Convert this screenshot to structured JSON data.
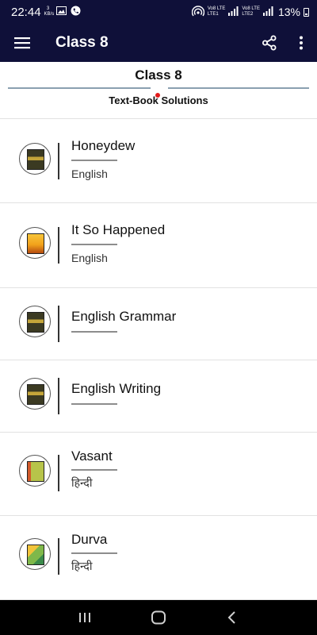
{
  "status": {
    "time": "22:44",
    "kbs_value": "3",
    "kbs_unit": "KB/s",
    "vo_lte1": "Vo8 LTE",
    "lte1": "LTE1",
    "vo_lte2": "Vo8 LTE",
    "lte2": "LTE2",
    "battery": "13%"
  },
  "appbar": {
    "title": "Class 8"
  },
  "header": {
    "class_label": "Class 8",
    "subtitle": "Text-Book Solutions"
  },
  "books": [
    {
      "title": "Honeydew",
      "language": "English",
      "cover_color": "#3b3a22",
      "cover_accent": "#c4a53a"
    },
    {
      "title": "It So Happened",
      "language": "English",
      "cover_color": "#f2a21b",
      "cover_accent": "#b54b10"
    },
    {
      "title": "English Grammar",
      "language": "",
      "cover_color": "#3b3a22",
      "cover_accent": "#c4a53a"
    },
    {
      "title": "English Writing",
      "language": "",
      "cover_color": "#3b3a22",
      "cover_accent": "#c4a53a"
    },
    {
      "title": "Vasant",
      "language": "हिन्दी",
      "cover_color": "#8fa83a",
      "cover_accent": "#d15a2a"
    },
    {
      "title": "Durva",
      "language": "हिन्दी",
      "cover_color": "#7fb84a",
      "cover_accent": "#f2c43a"
    }
  ],
  "colors": {
    "appbar": "#0f1039",
    "divider": "#8aa0b0",
    "red_dot": "#e21b1b"
  },
  "icons": [
    "menu-icon",
    "share-icon",
    "more-vert-icon",
    "recents-icon",
    "home-icon",
    "back-icon"
  ]
}
